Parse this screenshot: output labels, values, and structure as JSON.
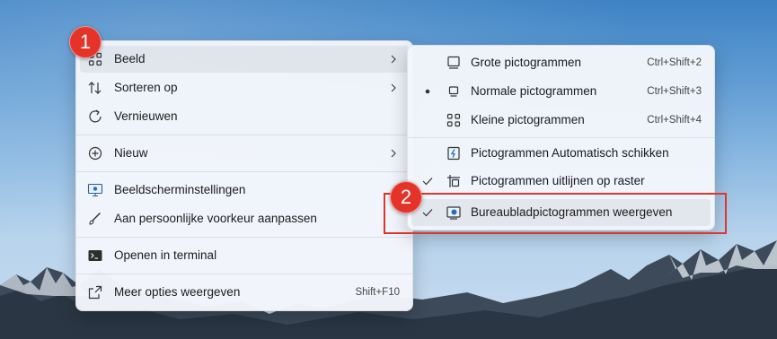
{
  "context_menu": {
    "items": [
      {
        "label": "Beeld",
        "icon": "view-grid-icon",
        "has_submenu": true
      },
      {
        "label": "Sorteren op",
        "icon": "sort-arrows-icon",
        "has_submenu": true
      },
      {
        "label": "Vernieuwen",
        "icon": "refresh-icon"
      },
      {
        "label": "Nieuw",
        "icon": "new-plus-icon",
        "has_submenu": true
      },
      {
        "label": "Beeldscherminstellingen",
        "icon": "display-settings-icon"
      },
      {
        "label": "Aan persoonlijke voorkeur aanpassen",
        "icon": "personalize-brush-icon"
      },
      {
        "label": "Openen in terminal",
        "icon": "terminal-icon"
      },
      {
        "label": "Meer opties weergeven",
        "icon": "more-options-icon",
        "shortcut": "Shift+F10"
      }
    ]
  },
  "view_submenu": {
    "items": [
      {
        "label": "Grote pictogrammen",
        "shortcut": "Ctrl+Shift+2",
        "icon": "large-icons-icon",
        "selected": false
      },
      {
        "label": "Normale pictogrammen",
        "shortcut": "Ctrl+Shift+3",
        "icon": "medium-icons-icon",
        "selected": true
      },
      {
        "label": "Kleine pictogrammen",
        "shortcut": "Ctrl+Shift+4",
        "icon": "small-icons-icon",
        "selected": false
      },
      {
        "label": "Pictogrammen Automatisch schikken",
        "icon": "auto-arrange-icon",
        "checked": false
      },
      {
        "label": "Pictogrammen uitlijnen op raster",
        "icon": "align-grid-icon",
        "checked": true
      },
      {
        "label": "Bureaubladpictogrammen weergeven",
        "icon": "show-desktop-icons-icon",
        "checked": true
      }
    ]
  },
  "annotations": {
    "step1": "1",
    "step2": "2",
    "color": "#e0352b"
  },
  "colors": {
    "menu_bg": "#f3f6fb",
    "highlight": "#e0352b"
  }
}
